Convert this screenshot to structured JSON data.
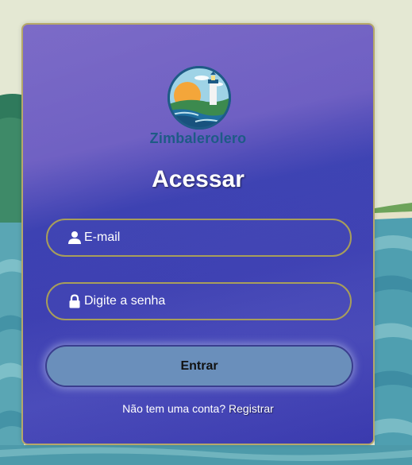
{
  "brand": {
    "name": "Zimbalerolero"
  },
  "login": {
    "title": "Acessar",
    "email_placeholder": "E-mail",
    "password_placeholder": "Digite a senha",
    "submit_label": "Entrar",
    "signup_prompt": "Não tem uma conta?",
    "signup_link": "Registrar"
  },
  "icons": {
    "email": "user-icon",
    "password": "lock-icon",
    "logo": "lighthouse-logo"
  },
  "colors": {
    "card_top": "#7462c4",
    "card_bottom": "#3b3db0",
    "field_border": "#a89e5a",
    "button_bg": "#6a8fbb",
    "brand_text": "#1e5b86"
  }
}
